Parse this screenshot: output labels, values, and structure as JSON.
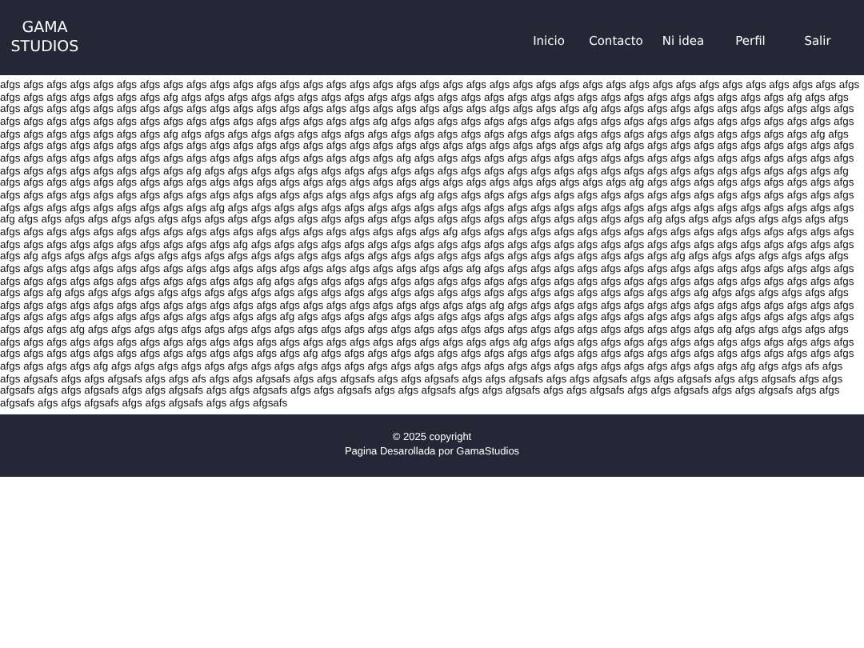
{
  "header": {
    "logo": "GAMA STUDIOS",
    "nav": [
      {
        "label": "Inicio"
      },
      {
        "label": "Contacto"
      },
      {
        "label": "Ni idea"
      },
      {
        "label": "Perfil"
      },
      {
        "label": "Salir"
      }
    ]
  },
  "content": {
    "paragraph": "afgs afgs afgs afgs afgs afgs afgs afgs afgs afgs afgs afgs afgs afgs afgs afgs afgs afgs afgs afgs afgs afgs afgs afgs afgs afgs afgs afgs afgs afgs afgs afgs afgs afgs afgs afgs afgs afgs afgs afgs afgs afgs afgs afgs afg afgs afgs afgs afgs afgs afgs afgs afgs afgs afgs afgs afgs afgs afgs afgs afgs afgs afgs afgs afgs afgs afgs afgs afgs afgs afgs afg afgs afgs afgs afgs afgs afgs afgs afgs afgs afgs afgs afgs afgs afgs afgs afgs afgs afgs afgs afgs afgs afgs afgs afgs afgs afgs afgs afg afgs afgs afgs afgs afgs afgs afgs afgs afgs afgs afgs afgs afgs afgs afgs afgs afgs afgs afgs afgs afgs afgs afgs afgs afgs afgs afgs afg afgs afgs afgs afgs afgs afgs afgs afgs afgs afgs afgs afgs afgs afgs afgs afgs afgs afgs afgs afgs afgs afgs afgs afgs afgs afgs afgs afg afgs afgs afgs afgs afgs afgs afgs afgs afgs afgs afgs afgs afgs afgs afgs afgs afgs afgs afgs afgs afgs afgs afgs afgs afgs afgs afgs afg afgs afgs afgs afgs afgs afgs afgs afgs afgs afgs afgs afgs afgs afgs afgs afgs afgs afgs afgs afgs afgs afgs afgs afgs afgs afgs afgs afg afgs afgs afgs afgs afgs afgs afgs afgs afgs afgs afgs afgs afgs afgs afgs afgs afgs afgs afgs afgs afgs afgs afgs afgs afgs afgs afgs afg afgs afgs afgs afgs afgs afgs afgs afgs afgs afgs afgs afgs afgs afgs afgs afgs afgs afgs afgs afgs afgs afgs afgs afgs afgs afgs afgs afg afgs afgs afgs afgs afgs afgs afgs afgs afgs afgs afgs afgs afgs afgs afgs afgs afgs afgs afgs afgs afgs afgs afgs afgs afgs afgs afgs afg afgs afgs afgs afgs afgs afgs afgs afgs afgs afgs afgs afgs afgs afgs afgs afgs afgs afgs afgs afgs afgs afgs afgs afgs afgs afgs afgs afg afgs afgs afgs afgs afgs afgs afgs afgs afgs afgs afgs afgs afgs afgs afgs afgs afgs afgs afgs afgs afgs afgs afgs afgs afgs afgs afgs afg afgs afgs afgs afgs afgs afgs afgs afgs afgs afgs afgs afgs afgs afgs afgs afgs afgs afgs afgs afgs afgs afgs afgs afgs afgs afgs afgs afg afgs afgs afgs afgs afgs afgs afgs afgs afgs afgs afgs afgs afgs afgs afgs afgs afgs afgs afgs afgs afgs afgs afgs afgs afgs afgs afgs afg afgs afgs afgs afgs afgs afgs afgs afgs afgs afgs afgs afgs afgs afgs afgs afgs afgs afgs afgs afgs afgs afgs afgs afgs afgs afgs afgs afg afgs afgs afgs afgs afgs afgs afgs afgs afgs afgs afgs afgs afgs afgs afgs afgs afgs afgs afgs afgs afgs afgs afgs afgs afgs afgs afgs afg afgs afgs afgs afgs afgs afgs afgs afgs afgs afgs afgs afgs afgs afgs afgs afgs afgs afgs afgs afgs afgs afgs afgs afgs afgs afgs afgs afg afgs afgs afgs afgs afgs afgs afgs afgs afgs afgs afgs afgs afgs afgs afgs afgs afgs afgs afgs afgs afgs afgs afgs afgs afgs afgs afgs afg afgs afgs afgs afgs afgs afgs afgs afgs afgs afgs afgs afgs afgs afgs afgs afgs afgs afgs afgs afgs afgs afgs afgs afgs afgs afgs afgs afg afgs afgs afgs afgs afgs afgs afgs afgs afgs afgs afgs afgs afgs afgs afgs afgs afgs afgs afgs afgs afgs afgs afgs afgs afgs afgs afgs afg afgs afgs afgs afgs afgs afgs afgs afgs afgs afgs afgs afgs afgs afgs afgs afgs afgs afgs afgs afgs afgs afgs afgs afgs afgs afgs afgs afg afgs afgs afgs afgs afgs afgs afgs afgs afgs afgs afgs afgs afgs afgs afgs afgs afgs afgs afgs afgs afgs afgs afgs afgs afgs afgs afgs afg afgs afgs afgs afgs afgs afgs afgs afgs afgs afgs afgs afgs afgs afgs afgs afgs afgs afgs afgs afgs afgs afgs afgs afgs afgs afgs afgs afg afgs afgs afgs afgs afgs afgs afgs afgs afgs afgs afgs afgs afgs afgs afgs afgs afgs afgs afgs afgs afgs afgs afgs afgs afgs afgs afgs afg afgs afgs afgs afgs afgs afgs afgs afgs afgs afgs afgs afgs afgs afgs afgs afgs afgs afgs afgs afgs afgs afgs afgs afgs afgs afgs afgs afg afgs afgs afgs afgs afgs afgs afgs afgs afgs afgs afgs afgs afgs afgs afgs afgs afgs afgs afgs afgs afgs afgs afgs afgs afgs afgs afgs afg afgs afgs afgs afgs afgs afgs afgs afgs afgs afgs afgs afgs afgs afgs afgs afgs afgs afgs afgs afgs afgs afgs afgs afgs afgs afgs afgs afg afgs afgs afgs afgs afgs afgs afgs afgs afgs afgs afgs afgs afgs afgs afgs afgs afgs afgs afgs afgs afgs afgs afgs afgs afgs afgs afgs afg afgs afgs afgs afgs afgs afgs afgs afgs afgs afgs afgs afgs afgs afgs afgs afgs afgs afgs afgs afgs afgs afgs afgs afgs afgs afgs afgs afg afgs afgs afgs afgs afgs afgs afgs afgs afgs afgs afgs afgs afgs afgs afgs afgs afgs afgs afgs afgs afgs afgs afgs afgs afgs afgs afgs afg afgs afgs afgs afgs afgs afgs afgs afgs afgs afgs afgs afgs afgs afgs afgs afgs afgs afgs afgs afgs afgs afgs afgs afgs afgs afgs afgs afg afgs afgs afs afgs afgs afgsafs afgs afgs afgsafs afgs afgs afs afgs afgs afgsafs afgs afgs afgsafs afgs afgs afgsafs afgs afgs afgsafs afgs afgs afgsafs afgs afgs afgsafs afgs afgs afgsafs afgs afgs afgsafs afgs afgs afgsafs afgs afgs afgsafs afgs afgs afgsafs afgs afgs afgsafs afgs afgs afgsafs afgs afgs afgsafs afgs afgs afgsafs afgs afgs afgsafs afgs afgs afgsafs afgs afgs afgsafs afgs afgs afgsafs afgs afgs afgsafs afgs afgs afgsafs"
  },
  "footer": {
    "copyright": "© 2025 copyright",
    "credit": "Pagina Desarollada por GamaStudios"
  }
}
